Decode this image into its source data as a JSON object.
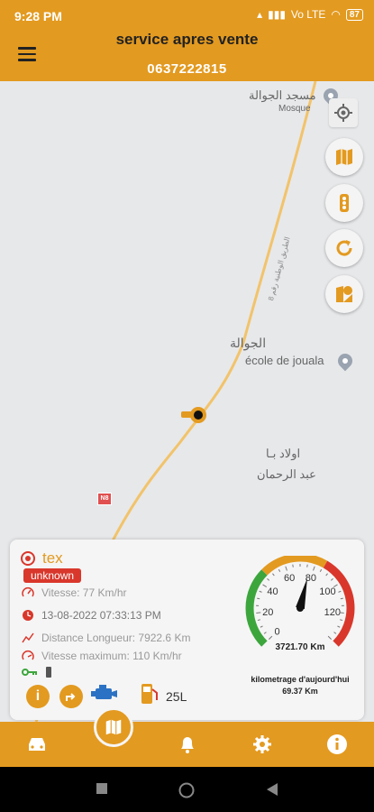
{
  "status_bar": {
    "time": "9:28 PM",
    "battery": "87",
    "network": "Vo LTE"
  },
  "header": {
    "title": "service apres vente",
    "phone": "0637222815"
  },
  "map": {
    "labels": {
      "mosque_ar": "مسجد الجوالة",
      "mosque_fr": "Mosque",
      "town_ar": "الجوالة",
      "school_fr": "école de jouala",
      "village_ar_1": "اولاد بـا",
      "village_ar_2": "عبد الرحمان",
      "road_badge": "N8",
      "road_name": "الطريق الوطنية رقم 8"
    },
    "accent_color": "#e39a20"
  },
  "vehicle": {
    "name": "tex",
    "status_badge": "unknown",
    "speed": "Vitesse: 77 Km/hr",
    "datetime": "13-08-2022 07:33:13 PM",
    "distance": "Distance Longueur: 7922.6 Km",
    "max_speed": "Vitesse maximum: 110 Km/hr",
    "fuel": "25L"
  },
  "gauge": {
    "ticks": [
      "0",
      "20",
      "40",
      "60",
      "80",
      "100",
      "120"
    ],
    "speed_value": 77,
    "odometer": "3721.70 Km",
    "daily_label": "kilometrage d'aujourd'hui",
    "daily_value": "69.37 Km"
  }
}
